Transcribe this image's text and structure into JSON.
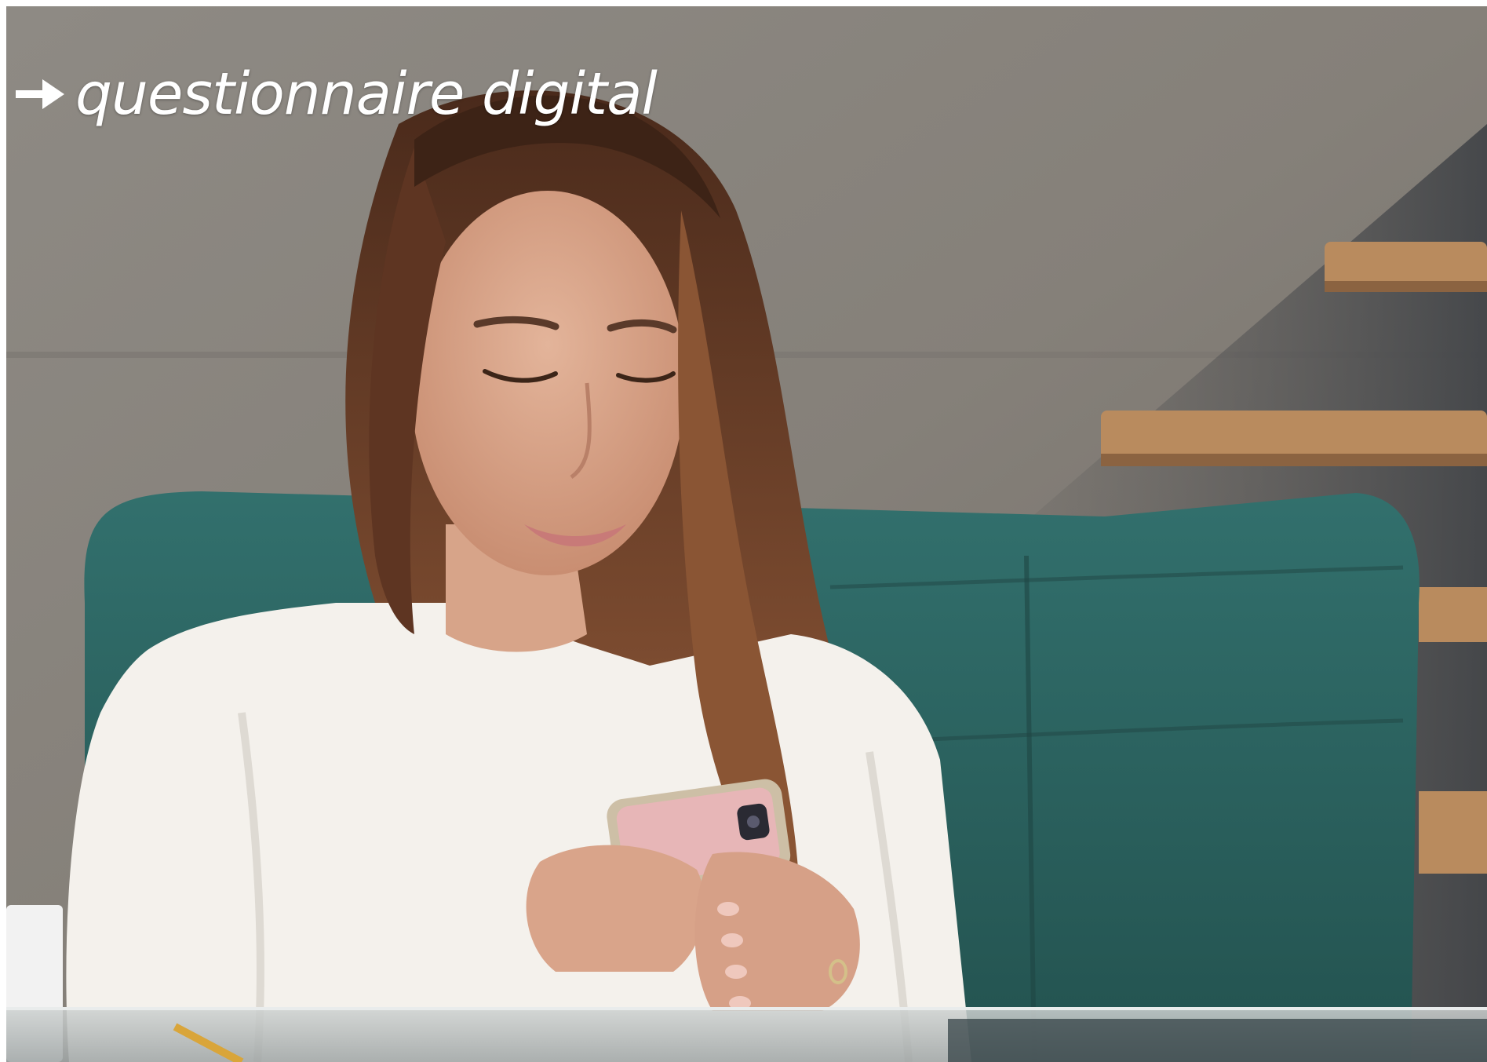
{
  "caption": {
    "icon": "right-arrow-icon",
    "text": "questionnaire digital"
  },
  "colors": {
    "wall": "#8d8882",
    "chair": "#2f6b69",
    "blouse": "#f4f1ec",
    "hair": "#6b3f28",
    "shelf_wood": "#b98b5e",
    "caption_text": "#ffffff"
  }
}
